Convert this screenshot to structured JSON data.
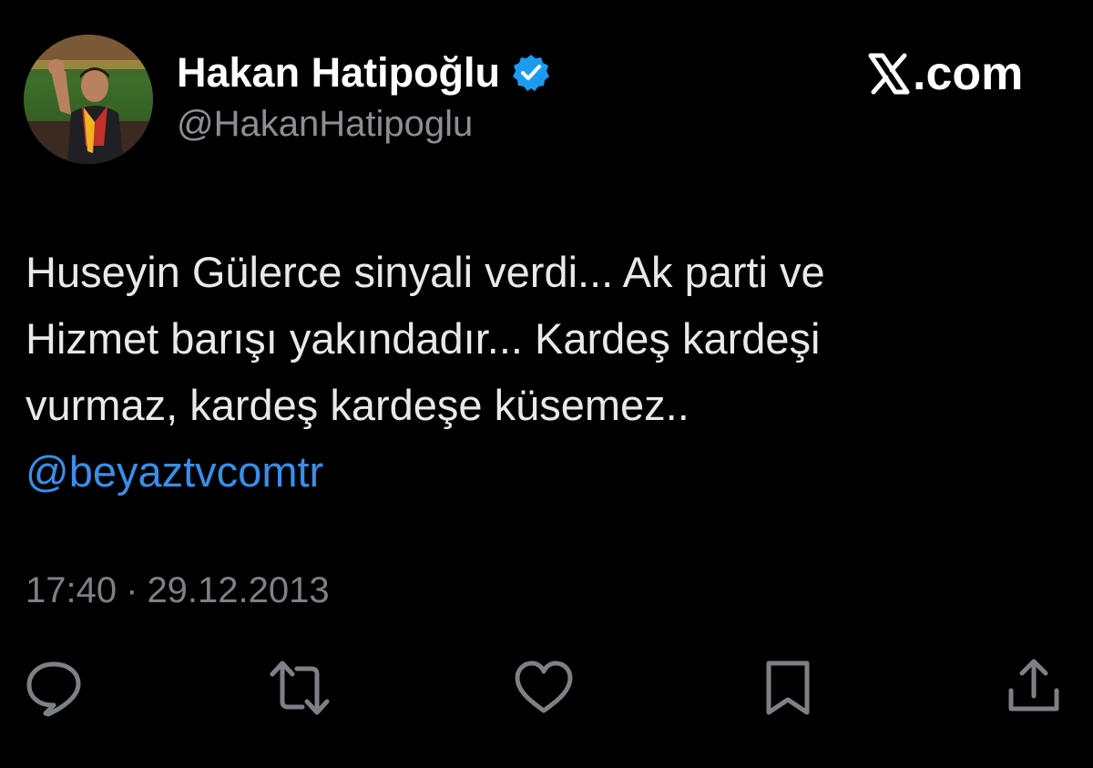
{
  "header": {
    "display_name": "Hakan Hatipoğlu",
    "handle": "@HakanHatipoglu",
    "verified": true,
    "verified_color": "#1d9bf0",
    "brand_text": ".com"
  },
  "tweet": {
    "lines": [
      "Huseyin Gülerce sinyali verdi... Ak parti ve",
      "Hizmet barışı yakındadır... Kardeş kardeşi",
      "vurmaz, kardeş kardeşe küsemez.."
    ],
    "mention": "@beyaztvcomtr",
    "mention_color": "#3b8ee8",
    "time": "17:40",
    "separator": "·",
    "date": "29.12.2013"
  },
  "actions": {
    "icons": [
      "reply-icon",
      "retweet-icon",
      "like-icon",
      "bookmark-icon",
      "share-icon"
    ]
  }
}
